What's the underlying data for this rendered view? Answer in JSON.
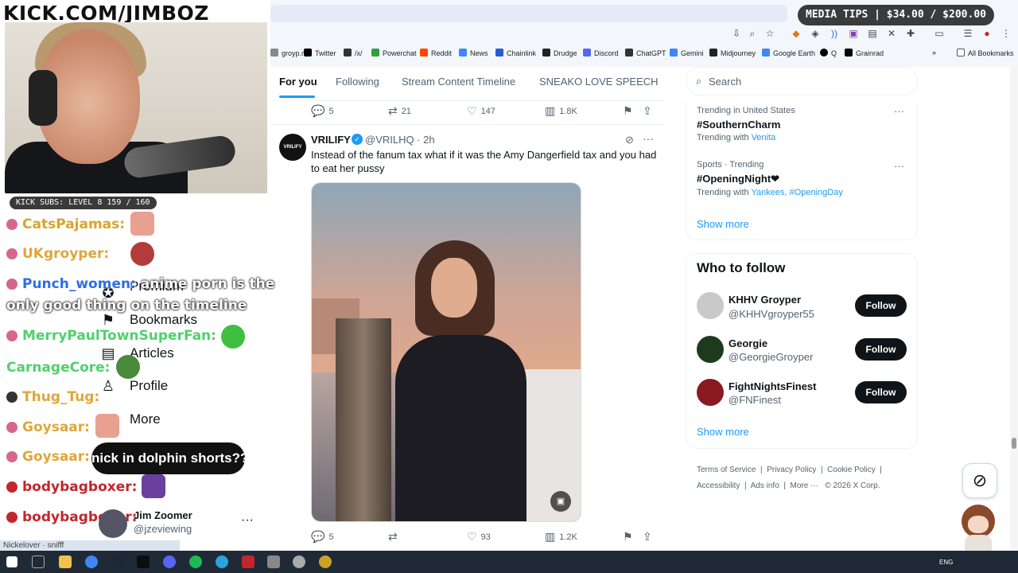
{
  "overlay": {
    "kick_title": "KICK.COM/JIMBOZ",
    "media_tips": "MEDIA TIPS | $34.00 / $200.00",
    "kick_subs": "KICK SUBS: LEVEL 8 159 / 160",
    "caption": "nick in dolphin shorts??",
    "status_url": "Nickelover · snifff",
    "chat": [
      {
        "user": "CatsPajamas:",
        "color": "#d8a42a",
        "message": ""
      },
      {
        "user": "UKgroyper:",
        "color": "#e0a63a",
        "message": ""
      },
      {
        "user": "Punch_women:",
        "color": "#2d6ee6",
        "message": "anime porn is the"
      },
      {
        "user": "",
        "color": "#ffffff",
        "message": "only good thing on the timeline"
      },
      {
        "user": "MerryPaulTownSuperFan:",
        "color": "#4fd16b",
        "message": ""
      },
      {
        "user": "CarnageCore:",
        "color": "#4fd16b",
        "message": ""
      },
      {
        "user": "Thug_Tug:",
        "color": "#e0a63a",
        "message": ""
      },
      {
        "user": "Goysaar:",
        "color": "#e0a63a",
        "message": ""
      },
      {
        "user": "Goysaar:",
        "color": "#e0a63a",
        "message": ""
      },
      {
        "user": "bodybagboxer:",
        "color": "#c1272d",
        "message": ""
      },
      {
        "user": "bodybagboxer:",
        "color": "#c1272d",
        "message": ""
      }
    ]
  },
  "sidebar_nav": {
    "premium": "Premium",
    "bookmarks": "Bookmarks",
    "articles": "Articles",
    "profile": "Profile",
    "more": "More",
    "account_name": "Jim Zoomer",
    "account_handle": "@jzeviewing"
  },
  "bookmarks": [
    {
      "label": "groyp.me",
      "color": "#888888"
    },
    {
      "label": "Twitter",
      "color": "#000000"
    },
    {
      "label": "/x/",
      "color": "#333333"
    },
    {
      "label": "Powerchat",
      "color": "#2ea043"
    },
    {
      "label": "Reddit",
      "color": "#ff4500"
    },
    {
      "label": "News",
      "color": "#4285f4"
    },
    {
      "label": "Chainlink",
      "color": "#2a5ada"
    },
    {
      "label": "Drudge",
      "color": "#222222"
    },
    {
      "label": "Discord",
      "color": "#5865f2"
    },
    {
      "label": "ChatGPT",
      "color": "#333333"
    },
    {
      "label": "Gemini",
      "color": "#4285f4"
    },
    {
      "label": "Midjourney",
      "color": "#222222"
    },
    {
      "label": "Google Earth",
      "color": "#4285f4"
    },
    {
      "label": "Q",
      "color": "#000000"
    },
    {
      "label": "Grainrad",
      "color": "#000000"
    },
    {
      "label": "All Bookmarks",
      "color": "#555555"
    }
  ],
  "feed_tabs": [
    "For you",
    "Following",
    "Stream Content Timeline",
    "SNEAKO LOVE SPEECH"
  ],
  "prev_post_actions": {
    "replies": "5",
    "reposts": "21",
    "likes": "147",
    "views": "1.8K"
  },
  "post": {
    "avatar_text": "VRILIFY",
    "author": "VRILIFY",
    "handle_time": "@VRILHQ · 2h",
    "text": "Instead of the fanum tax what if it was the Amy Dangerfield tax and you had to eat her pussy",
    "actions": {
      "replies": "5",
      "reposts": "",
      "likes": "93",
      "views": "1.2K"
    }
  },
  "search": {
    "placeholder": "Search"
  },
  "trends": [
    {
      "meta": "Trending in United States",
      "name": "#SouthernCharm",
      "with_label": "Trending with",
      "with": "Venita"
    },
    {
      "meta": "Sports · Trending",
      "name": "#OpeningNight❤",
      "with_label": "Trending with",
      "with": "Yankees, #OpeningDay"
    }
  ],
  "show_more": "Show more",
  "who_to_follow": {
    "title": "Who to follow",
    "follow_label": "Follow",
    "accounts": [
      {
        "name": "KHHV Groyper",
        "handle": "@KHHVgroyper55"
      },
      {
        "name": "Georgie",
        "handle": "@GeorgieGroyper"
      },
      {
        "name": "FightNightsFinest",
        "handle": "@FNFinest"
      }
    ],
    "show_more": "Show more"
  },
  "footer": {
    "terms": "Terms of Service",
    "privacy": "Privacy Policy",
    "cookie": "Cookie Policy",
    "accessibility": "Accessibility",
    "ads": "Ads info",
    "more": "More ···",
    "copyright": "© 2026 X Corp."
  },
  "taskbar": {
    "lang": "ENG"
  },
  "colors": {
    "accent": "#1d9bf0",
    "text": "#0f1419",
    "muted": "#536471"
  }
}
